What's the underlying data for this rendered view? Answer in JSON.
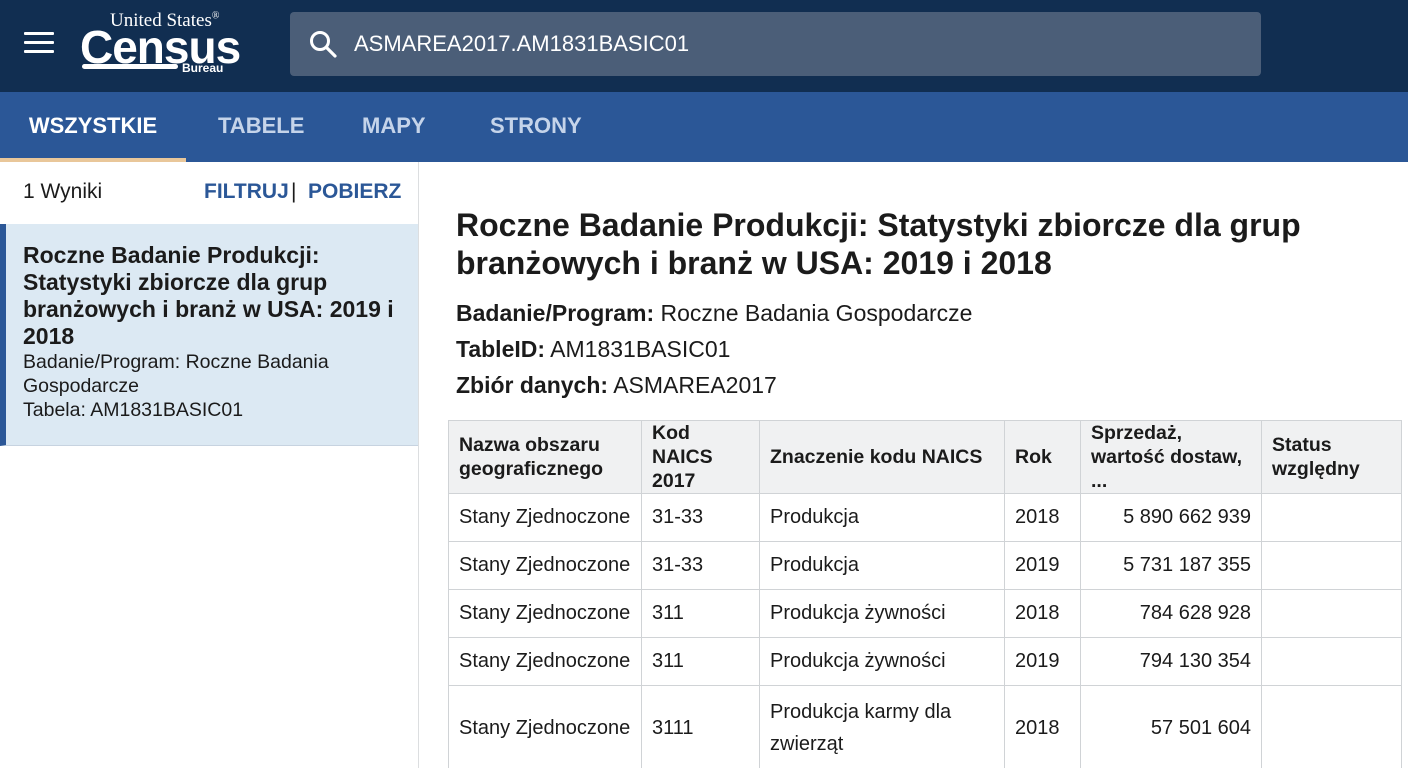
{
  "header": {
    "logo": {
      "line1": "United States",
      "registered": "®",
      "line2": "Census",
      "line3": "Bureau"
    },
    "search": {
      "value": "ASMAREA2017.AM1831BASIC01"
    }
  },
  "tabs": [
    {
      "label": "WSZYSTKIE",
      "active": true
    },
    {
      "label": "TABELE",
      "active": false
    },
    {
      "label": "MAPY",
      "active": false
    },
    {
      "label": "STRONY",
      "active": false
    }
  ],
  "sidebar": {
    "results_count": "1 Wyniki",
    "filter_label": "FILTRUJ",
    "separator": "|",
    "download_label": "POBIERZ",
    "result": {
      "title": "Roczne Badanie Produkcji: Statystyki zbiorcze dla grup branżowych i branż w USA: 2019 i 2018",
      "program": "Badanie/Program: Roczne Badania Gospodarcze",
      "table": "Tabela: AM1831BASIC01"
    }
  },
  "main": {
    "title": "Roczne Badanie Produkcji: Statystyki zbiorcze dla grup branżowych i branż w USA: 2019 i 2018",
    "program_label": "Badanie/Program:",
    "program_value": "Roczne Badania Gospodarcze",
    "tableid_label": "TableID:",
    "tableid_value": "AM1831BASIC01",
    "dataset_label": "Zbiór danych:",
    "dataset_value": "ASMAREA2017",
    "table": {
      "headers": [
        "Nazwa obszaru geograficznego",
        "Kod NAICS 2017",
        "Znaczenie kodu NAICS",
        "Rok",
        "Sprzedaż, wartość dostaw, ...",
        "Status względny"
      ],
      "rows": [
        [
          "Stany Zjednoczone",
          "31-33",
          "Produkcja",
          "2018",
          "5 890 662 939",
          ""
        ],
        [
          "Stany Zjednoczone",
          "31-33",
          "Produkcja",
          "2019",
          "5 731 187 355",
          ""
        ],
        [
          "Stany Zjednoczone",
          "311",
          "Produkcja żywności",
          "2018",
          "784 628 928",
          ""
        ],
        [
          "Stany Zjednoczone",
          "311",
          "Produkcja żywności",
          "2019",
          "794 130 354",
          ""
        ],
        [
          "Stany Zjednoczone",
          "3111",
          "Produkcja karmy dla zwierząt",
          "2018",
          "57 501 604",
          ""
        ]
      ]
    }
  },
  "colors": {
    "header_bg": "#112e51",
    "tab_bg": "#2b5797",
    "active_tab_underline": "#e9c79a",
    "selected_result_bg": "#dce9f3",
    "link": "#2b5797"
  }
}
